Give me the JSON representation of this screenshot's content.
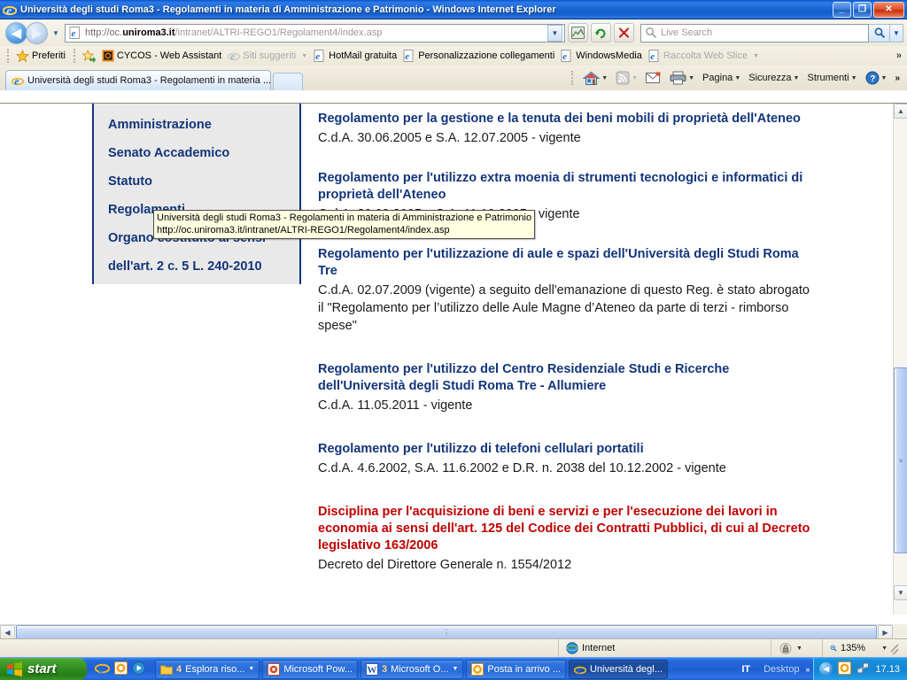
{
  "window": {
    "title": "Università degli studi Roma3 - Regolamenti in materia di Amministrazione e Patrimonio - Windows Internet Explorer",
    "minimize_label": "_",
    "maximize_label": "❐",
    "close_label": "✕"
  },
  "nav": {
    "back_label": "◀",
    "forward_label": "▶",
    "history_dropdown": "▼",
    "address": {
      "scheme": "http://oc.",
      "domain": "uniroma3.it",
      "path": "/intranet/ALTRI-REGO1/Regolament4/index.asp",
      "full": "http://oc.uniroma3.it/intranet/ALTRI-REGO1/Regolament4/index.asp",
      "dropdown": "▼"
    },
    "compat_button": "⛰",
    "refresh_button": "↻",
    "stop_button": "✕",
    "search": {
      "placeholder": "Live Search",
      "go_label": "🔍",
      "dropdown": "▼"
    }
  },
  "favorites_bar": {
    "favorites_label": "Preferiti",
    "items": [
      {
        "label": "CYCOS - Web Assistant",
        "icon": "cycos-icon",
        "dim": false,
        "dropdown": false
      },
      {
        "label": "Siti suggeriti",
        "icon": "ie-icon",
        "dim": true,
        "dropdown": true
      },
      {
        "label": "HotMail gratuita",
        "icon": "ie-page-icon",
        "dim": false,
        "dropdown": false
      },
      {
        "label": "Personalizzazione collegamenti",
        "icon": "ie-page-icon",
        "dim": false,
        "dropdown": false
      },
      {
        "label": "WindowsMedia",
        "icon": "ie-page-icon",
        "dim": false,
        "dropdown": false
      },
      {
        "label": "Raccolta Web Slice",
        "icon": "ie-page-icon",
        "dim": true,
        "dropdown": true
      }
    ],
    "overflow": "»"
  },
  "tabs": {
    "items": [
      {
        "label": "Università degli studi Roma3 - Regolamenti in materia ...",
        "active": true
      }
    ],
    "new_tab_label": ""
  },
  "command_bar": {
    "items": [
      {
        "label": "",
        "icon": "home-icon",
        "dropdown": true,
        "dim": false
      },
      {
        "label": "",
        "icon": "feeds-icon",
        "dropdown": true,
        "dim": true
      },
      {
        "label": "",
        "icon": "mail-icon",
        "dropdown": false,
        "dim": false
      },
      {
        "label": "",
        "icon": "print-icon",
        "dropdown": true,
        "dim": false
      },
      {
        "label": "Pagina",
        "icon": "",
        "dropdown": true,
        "dim": false
      },
      {
        "label": "Sicurezza",
        "icon": "",
        "dropdown": true,
        "dim": false
      },
      {
        "label": "Strumenti",
        "icon": "",
        "dropdown": true,
        "dim": false
      },
      {
        "label": "",
        "icon": "help-icon",
        "dropdown": true,
        "dim": false
      }
    ],
    "overflow": "»"
  },
  "tooltip": {
    "line1": "Università degli studi Roma3 - Regolamenti in materia di Amministrazione e Patrimonio",
    "line2": "http://oc.uniroma3.it/intranet/ALTRI-REGO1/Regolament4/index.asp"
  },
  "sidebar": {
    "links": [
      "Amministrazione",
      "Senato Accademico",
      "Statuto",
      "Regolamenti",
      "Organo costituito ai sensi",
      "dell'art. 2 c. 5 L. 240-2010"
    ]
  },
  "content": {
    "entries": [
      {
        "title": "Regolamento per la gestione e la tenuta dei beni mobili di proprietà dell'Ateneo",
        "title_color": "navy",
        "detail": "C.d.A. 30.06.2005 e S.A. 12.07.2005 - vigente"
      },
      {
        "title": "Regolamento per l'utilizzo extra moenia di strumenti tecnologici e informatici di proprietà dell'Ateneo",
        "title_color": "navy",
        "detail": "C.d.A. 20.09.2005 e S.A. 11.10.2005 - vigente"
      },
      {
        "title": "Regolamento per l'utilizzazione di aule e spazi dell'Università degli Studi Roma Tre",
        "title_color": "navy",
        "detail": "C.d.A. 02.07.2009 (vigente) a seguito dell'emanazione di questo Reg. è stato abrogato il \"Regolamento per l’utilizzo delle Aule Magne d’Ateneo da parte di terzi - rimborso spese\""
      },
      {
        "title": "Regolamento per l'utilizzo del Centro Residenziale Studi e Ricerche dell'Università degli Studi Roma Tre - Allumiere",
        "title_color": "navy",
        "detail": "C.d.A. 11.05.2011 - vigente"
      },
      {
        "title": "Regolamento per l'utilizzo di telefoni cellulari portatili",
        "title_color": "navy",
        "detail": "C.d.A. 4.6.2002, S.A. 11.6.2002 e D.R. n. 2038 del 10.12.2002 - vigente"
      },
      {
        "title": "Disciplina per l'acquisizione di beni e servizi e per l'esecuzione dei lavori in economia ai sensi dell'art. 125 del Codice dei Contratti Pubblici, di cui al Decreto legislativo 163/2006",
        "title_color": "red",
        "detail": "Decreto del Direttore Generale n. 1554/2012"
      }
    ]
  },
  "scrollbars": {
    "vertical": {
      "up_arrow": "▲",
      "down_arrow": "▼",
      "grip": "≡"
    },
    "horizontal": {
      "left_arrow": "◀",
      "right_arrow": "▶",
      "grip": "⋮"
    }
  },
  "statusbar": {
    "zone_label": "Internet",
    "zone_icon": "globe-icon",
    "protected_icon": "lock-icon",
    "protected_dropdown": "▼",
    "zoom_icon": "zoom-icon",
    "zoom_level": "135%",
    "zoom_dropdown": "▼"
  },
  "taskbar": {
    "start_label": "start",
    "quick_launch": [
      "ie-icon",
      "office-icon",
      "media-player-icon"
    ],
    "tasks": [
      {
        "count": "4",
        "label": "Esplora riso...",
        "icon": "folder-icon",
        "dropdown": true,
        "active": false
      },
      {
        "count": "",
        "label": "Microsoft Pow...",
        "icon": "powerpoint-icon",
        "dropdown": false,
        "active": false
      },
      {
        "count": "3",
        "label": "Microsoft O...",
        "icon": "word-icon",
        "dropdown": true,
        "active": false
      },
      {
        "count": "",
        "label": "Posta in arrivo ...",
        "icon": "outlook-icon",
        "dropdown": false,
        "active": false
      },
      {
        "count": "",
        "label": "Università degl...",
        "icon": "ie-icon",
        "dropdown": false,
        "active": true
      }
    ],
    "language": "IT",
    "desktop_label": "Desktop",
    "tray_chevron": "»",
    "tray_icons": [
      "show-hidden-icon",
      "outlook-tray-icon",
      "network-tray-icon"
    ],
    "clock": "17.13"
  },
  "colors": {
    "navy": "#12357a",
    "red": "#c00000",
    "title_gradient_start": "#0a56c8",
    "tooltip_bg": "#ffffe1",
    "sidebar_bg": "#e9e9e9"
  }
}
